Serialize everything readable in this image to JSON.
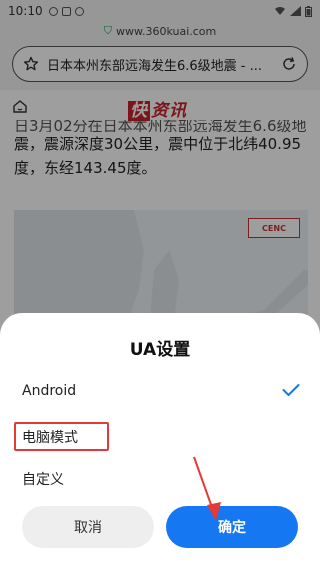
{
  "status_bar": {
    "time": "10:10"
  },
  "browser": {
    "url": "www.360kuai.com",
    "page_title": "日本本州东部远海发生6.6级地震 - ..."
  },
  "web": {
    "logo": "快资讯",
    "article_clip": "日3月02分在日本本州东部远海发生6.6级地",
    "article_lines": [
      "震，震源深度30公里，震中位于北纬40.95",
      "度，东经143.45度。"
    ],
    "map_badge": "CENC"
  },
  "dialog": {
    "title": "UA设置",
    "options": [
      {
        "label": "Android",
        "selected": true
      },
      {
        "label": "电脑模式",
        "selected": false
      },
      {
        "label": "自定义",
        "selected": false
      }
    ],
    "cancel_label": "取消",
    "ok_label": "确定"
  },
  "colors": {
    "accent": "#1677f2",
    "highlight": "#e53935",
    "brand_red": "#c8232c"
  }
}
